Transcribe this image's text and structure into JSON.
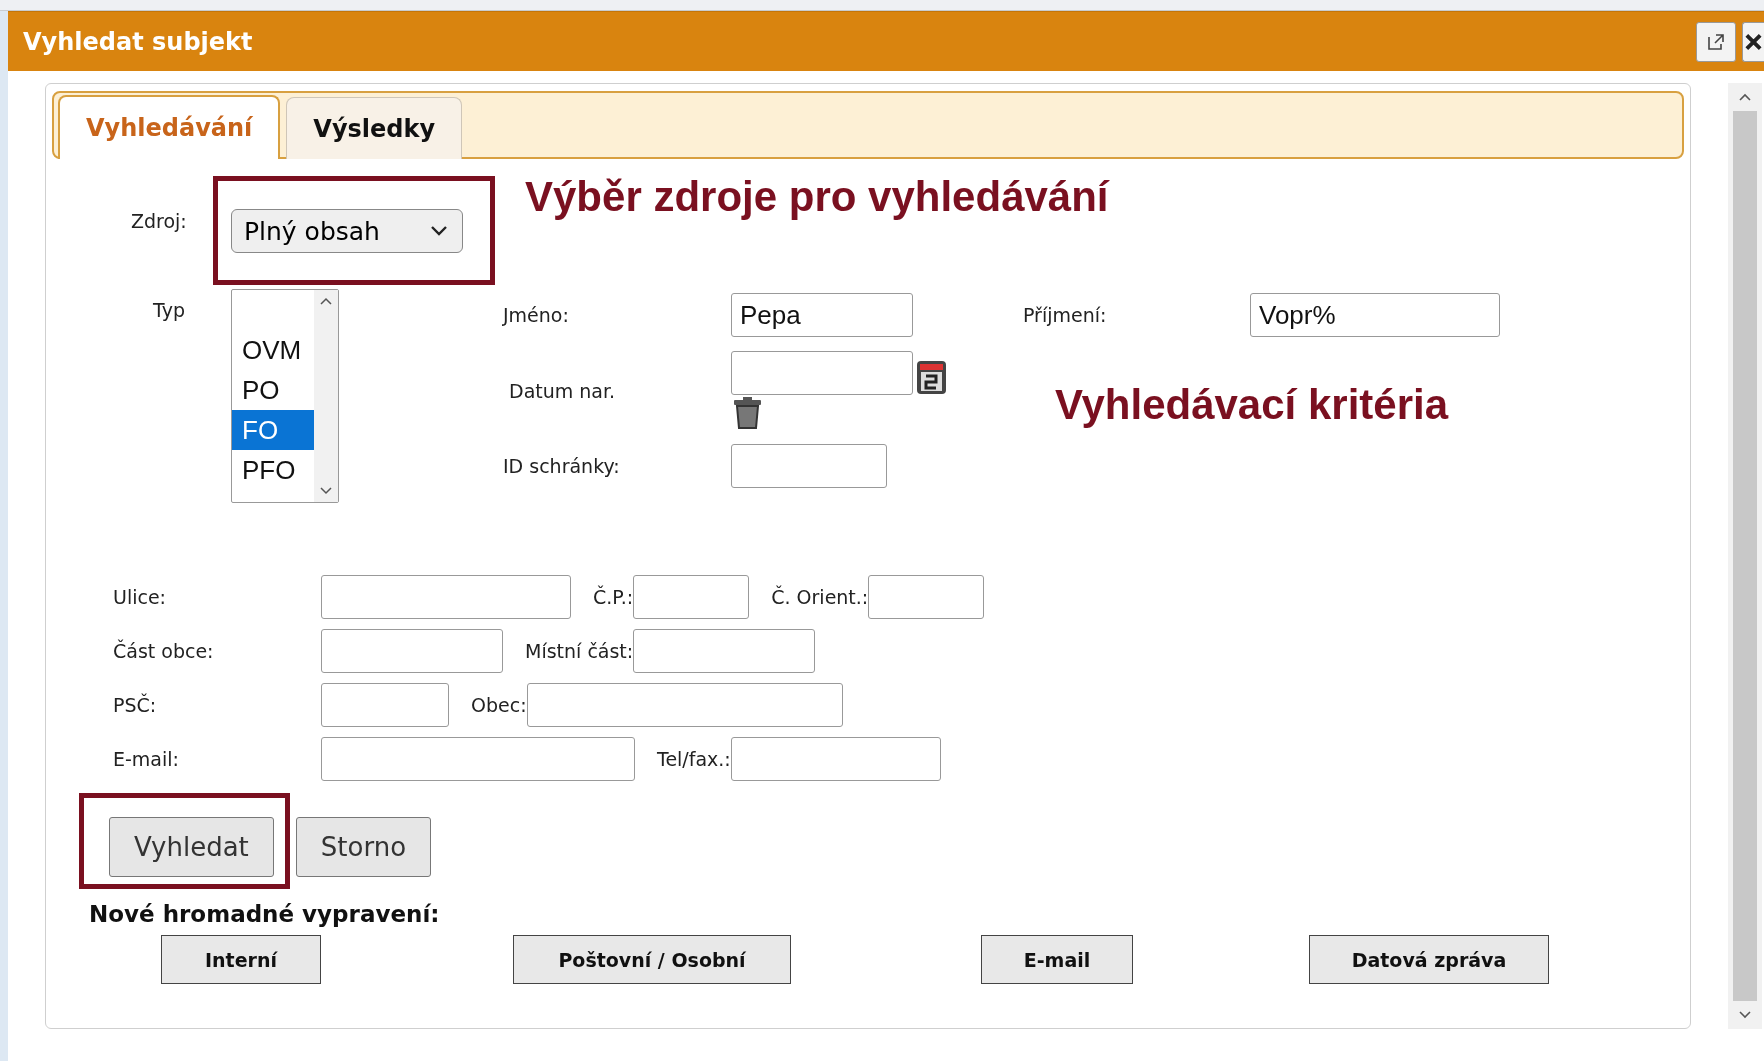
{
  "dialog": {
    "title": "Vyhledat subjekt"
  },
  "tabs": [
    {
      "label": "Vyhledávání",
      "selected": true
    },
    {
      "label": "Výsledky",
      "selected": false
    }
  ],
  "source": {
    "label": "Zdroj:",
    "value": "Plný obsah",
    "highlighted": true
  },
  "annotations": [
    "Výběr zdroje pro vyhledávání",
    "Vyhledávací kritéria"
  ],
  "type_list": {
    "label": "Typ",
    "options": [
      {
        "label": "OVM",
        "selected": false
      },
      {
        "label": "PO",
        "selected": false
      },
      {
        "label": "FO",
        "selected": true
      },
      {
        "label": "PFO",
        "selected": false
      }
    ]
  },
  "person": {
    "first_name": {
      "label": "Jméno:",
      "value": "Pepa"
    },
    "last_name": {
      "label": "Příjmení:",
      "value": "Vopr%"
    },
    "birth_date": {
      "label": "Datum nar."
    },
    "mailbox_id": {
      "label": "ID schránky:"
    }
  },
  "address_rows": [
    {
      "fields": [
        {
          "label": "Ulice:"
        },
        {
          "label": "Č.P.:"
        },
        {
          "label": "Č. Orient.:"
        }
      ]
    },
    {
      "fields": [
        {
          "label": "Část obce:"
        },
        {
          "label": "Místní část:"
        }
      ]
    },
    {
      "fields": [
        {
          "label": "PSČ:"
        },
        {
          "label": "Obec:"
        }
      ]
    },
    {
      "fields": [
        {
          "label": "E-mail:"
        },
        {
          "label": "Tel/fax.:"
        }
      ]
    }
  ],
  "actions": [
    {
      "label": "Vyhledat",
      "highlighted": true
    },
    {
      "label": "Storno",
      "highlighted": false
    }
  ],
  "bulk": {
    "title": "Nové hromadné vypravení:",
    "buttons": [
      "Interní",
      "Poštovní / Osobní",
      "E-mail",
      "Datová zpráva"
    ]
  }
}
